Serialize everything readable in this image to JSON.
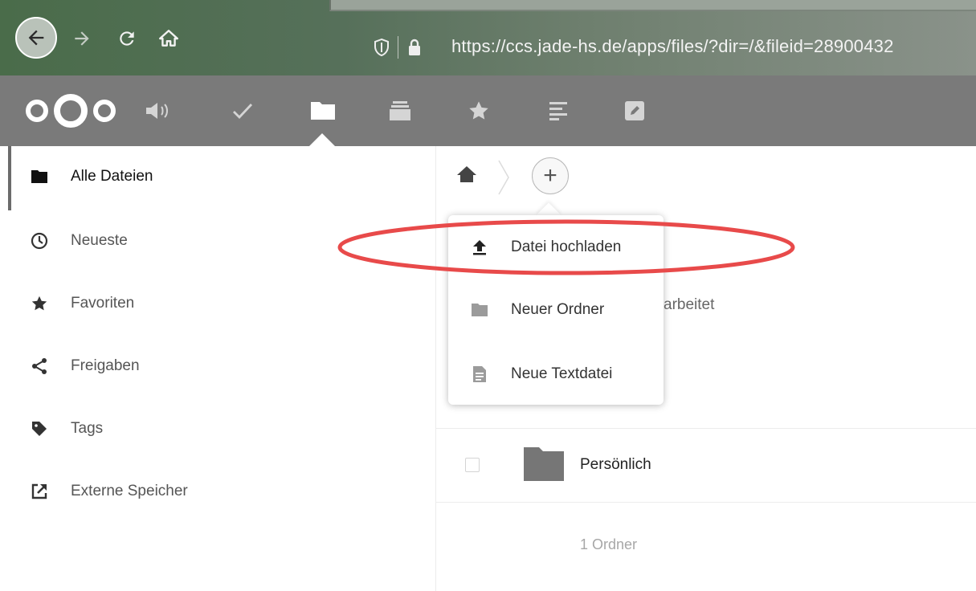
{
  "browser": {
    "url": "https://ccs.jade-hs.de/apps/files/?dir=/&fileid=28900432"
  },
  "header": {
    "apps": [
      {
        "name": "activity-icon"
      },
      {
        "name": "tasks-check-icon"
      },
      {
        "name": "files-folder-icon",
        "active": true
      },
      {
        "name": "deck-icon"
      },
      {
        "name": "favorites-star-icon"
      },
      {
        "name": "notes-icon"
      },
      {
        "name": "edit-icon"
      }
    ]
  },
  "sidebar": {
    "items": [
      {
        "label": "Alle Dateien",
        "icon": "folder-icon",
        "active": true
      },
      {
        "label": "Neueste",
        "icon": "clock-icon"
      },
      {
        "label": "Favoriten",
        "icon": "star-icon"
      },
      {
        "label": "Freigaben",
        "icon": "share-icon"
      },
      {
        "label": "Tags",
        "icon": "tag-icon"
      },
      {
        "label": "Externe Speicher",
        "icon": "external-storage-icon"
      }
    ]
  },
  "new_menu": {
    "items": [
      {
        "label": "Datei hochladen",
        "icon": "upload-icon"
      },
      {
        "label": "Neuer Ordner",
        "icon": "folder-icon"
      },
      {
        "label": "Neue Textdatei",
        "icon": "text-file-icon"
      }
    ],
    "plus_label": "+"
  },
  "files": {
    "background_text": "arbeitet",
    "rows": [
      {
        "name": "Persönlich"
      }
    ],
    "summary": "1 Ordner"
  },
  "colors": {
    "header_bg": "#7a7a7a",
    "highlight_ring": "#e84a4a"
  }
}
